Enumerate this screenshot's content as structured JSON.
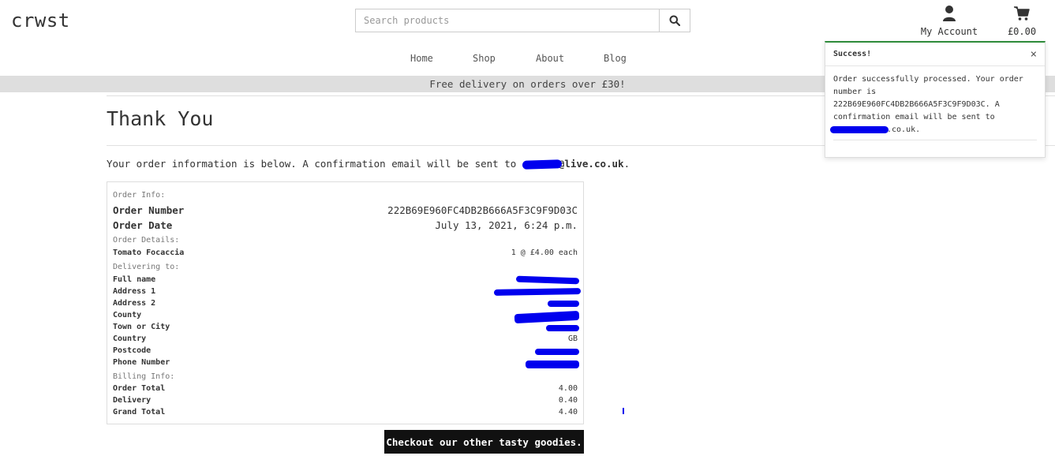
{
  "header": {
    "logo": "crwst",
    "search_placeholder": "Search products",
    "search_icon": "search-icon",
    "account_label": "My Account",
    "account_icon": "user-icon",
    "cart_total": "£0.00",
    "cart_icon": "shopping-cart-icon"
  },
  "nav": {
    "items": [
      {
        "label": "Home"
      },
      {
        "label": "Shop"
      },
      {
        "label": "About"
      },
      {
        "label": "Blog"
      }
    ]
  },
  "banner": {
    "text": "Free delivery on orders over £30!"
  },
  "page": {
    "title": "Thank You",
    "intro_text": "Your order information is below. A confirmation email will be sent to ",
    "intro_email_visible": "@live.co.uk",
    "intro_end": "."
  },
  "order": {
    "order_info_heading": "Order Info:",
    "order_number_label": "Order Number",
    "order_number": "222B69E960FC4DB2B666A5F3C9F9D03C",
    "order_date_label": "Order Date",
    "order_date": "July 13, 2021, 6:24 p.m.",
    "order_details_heading": "Order Details:",
    "item_name": "Tomato Focaccia",
    "item_qty_price": "1 @ £4.00 each",
    "delivering_heading": "Delivering to:",
    "delivery_fields": [
      {
        "label": "Full name"
      },
      {
        "label": "Address 1"
      },
      {
        "label": "Address 2"
      },
      {
        "label": "County"
      },
      {
        "label": "Town or City"
      },
      {
        "label": "Country",
        "value": "GB"
      },
      {
        "label": "Postcode"
      },
      {
        "label": "Phone Number"
      }
    ],
    "billing_heading": "Billing Info:",
    "order_total_label": "Order Total",
    "order_total": "4.00",
    "delivery_label": "Delivery",
    "delivery": "0.40",
    "grand_total_label": "Grand Total",
    "grand_total": "4.40"
  },
  "cta": {
    "label": "Checkout our other tasty goodies."
  },
  "toast": {
    "title": "Success!",
    "close": "×",
    "body_1": "Order successfully processed. Your order number is 222B69E960FC4DB2B666A5F3C9F9D03C. A confirmation email will be sent to ",
    "body_email_visible": ".co.uk."
  },
  "colors": {
    "banner_bg": "#dedede",
    "cta_bg": "#111111",
    "toast_accent": "#2e8b3a",
    "redaction": "#0000ee"
  }
}
